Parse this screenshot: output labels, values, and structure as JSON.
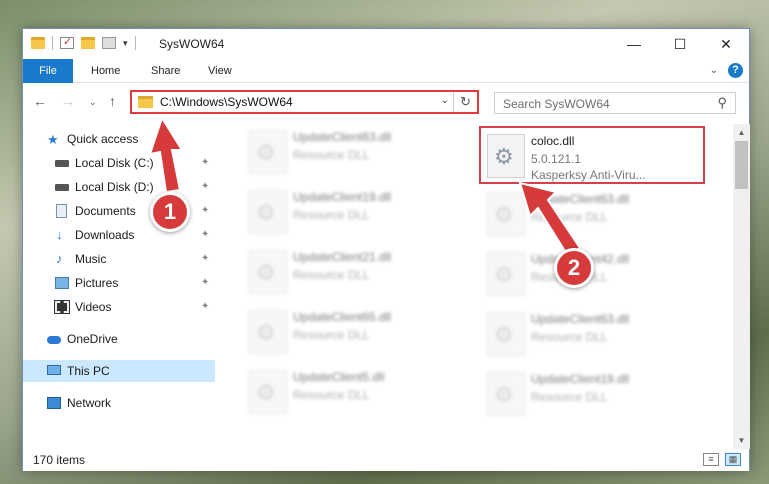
{
  "window": {
    "title": "SysWOW64",
    "minimize": "—",
    "maximize": "☐",
    "close": "✕"
  },
  "ribbon": {
    "tabs": [
      "File",
      "Home",
      "Share",
      "View"
    ]
  },
  "nav": {
    "back": "←",
    "forward": "→",
    "recent": "⌄",
    "up": "↑",
    "address": "C:\\Windows\\SysWOW64",
    "refresh": "↻",
    "search_placeholder": "Search SysWOW64"
  },
  "sidebar": {
    "items": [
      {
        "label": "Quick access",
        "icon": "star-icon",
        "pinned": false
      },
      {
        "label": "Local Disk (C:)",
        "icon": "disk-icon",
        "pinned": true
      },
      {
        "label": "Local Disk (D:)",
        "icon": "disk-icon",
        "pinned": true
      },
      {
        "label": "Documents",
        "icon": "documents-icon",
        "pinned": true
      },
      {
        "label": "Downloads",
        "icon": "download-icon",
        "pinned": true
      },
      {
        "label": "Music",
        "icon": "music-icon",
        "pinned": true
      },
      {
        "label": "Pictures",
        "icon": "pictures-icon",
        "pinned": true
      },
      {
        "label": "Videos",
        "icon": "videos-icon",
        "pinned": true
      },
      {
        "label": "OneDrive",
        "icon": "onedrive-icon",
        "pinned": false
      },
      {
        "label": "This PC",
        "icon": "pc-icon",
        "pinned": false,
        "selected": true
      },
      {
        "label": "Network",
        "icon": "network-icon",
        "pinned": false
      }
    ],
    "pin_glyph": "📌"
  },
  "files": {
    "left_column": [
      {
        "name": "UpdateClient63.dll",
        "type": "Resource DLL"
      },
      {
        "name": "UpdateClient19.dll",
        "type": "Resource DLL"
      },
      {
        "name": "UpdateClient21.dll",
        "type": "Resource DLL"
      },
      {
        "name": "UpdateClient65.dll",
        "type": "Resource DLL"
      },
      {
        "name": "UpdateClient5.dll",
        "type": "Resource DLL"
      }
    ],
    "highlighted": {
      "name": "coloc.dll",
      "version": "5.0.121.1",
      "company": "Kasperksy Anti-Viru..."
    },
    "right_column": [
      {
        "name": "UpdateClient63.dll",
        "type": "Resource DLL"
      },
      {
        "name": "UpdateClient42.dll",
        "type": "Resource DLL"
      },
      {
        "name": "UpdateClient63.dll",
        "type": "Resource DLL"
      },
      {
        "name": "UpdateClient19.dll",
        "type": "Resource DLL"
      }
    ]
  },
  "status": {
    "item_count": "170 items"
  },
  "annotations": {
    "step1": "1",
    "step2": "2",
    "color": "#d63a3a"
  }
}
